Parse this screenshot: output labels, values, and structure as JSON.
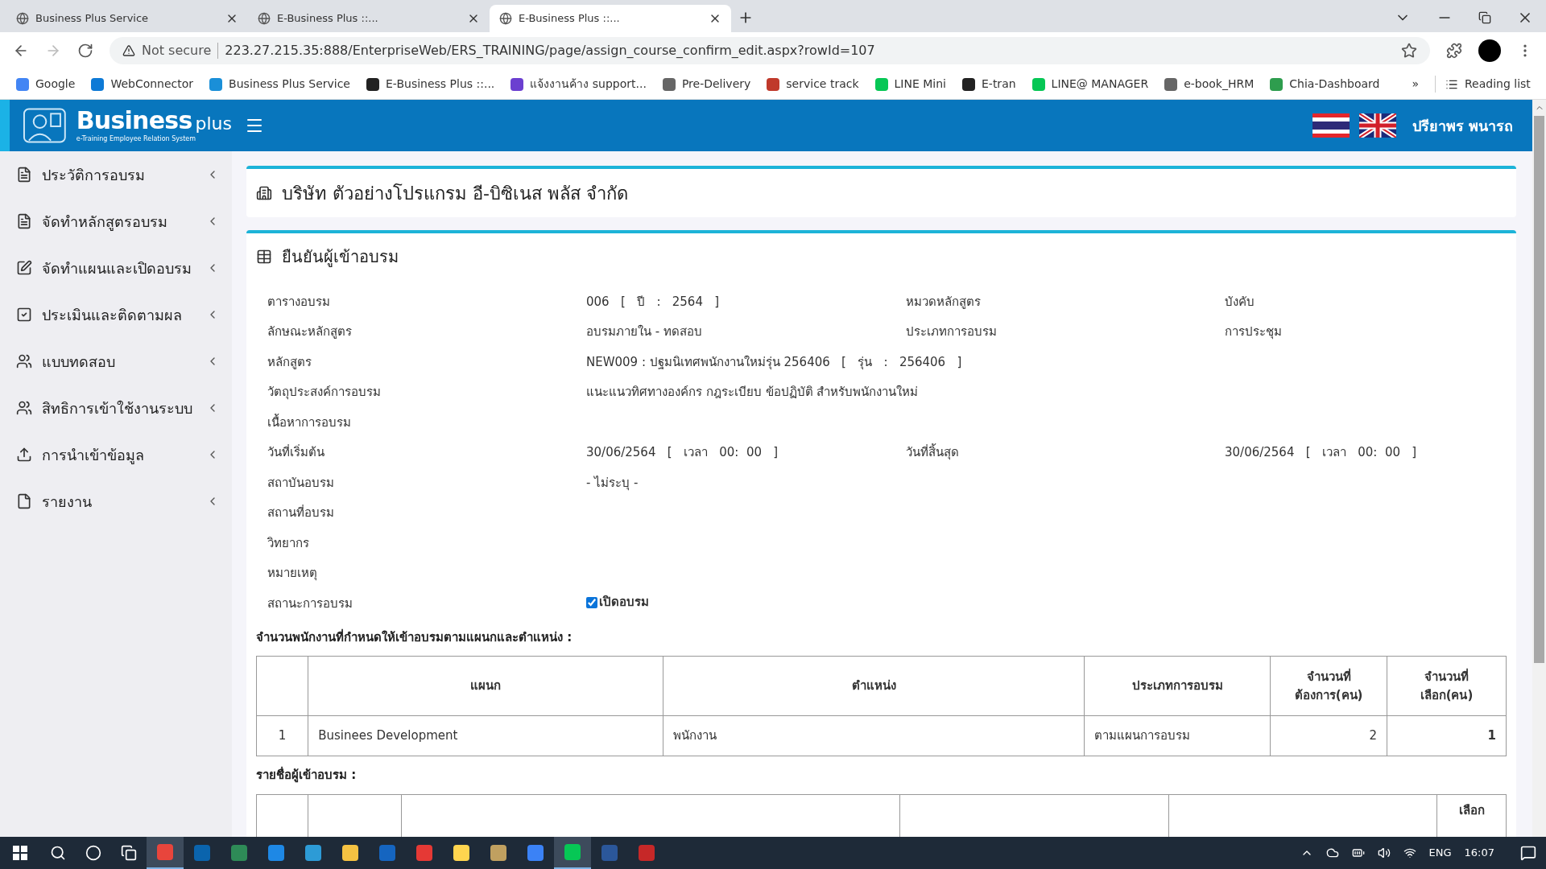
{
  "browser": {
    "tabs": [
      {
        "title": "Business Plus Service",
        "selected": false
      },
      {
        "title": "E-Business Plus ::...",
        "selected": false
      },
      {
        "title": "E-Business Plus ::...",
        "selected": true
      }
    ],
    "security": "Not secure",
    "url": "223.27.215.35:888/EnterpriseWeb/ERS_TRAINING/page/assign_course_confirm_edit.aspx?rowId=107",
    "bookmarks": [
      "Google",
      "WebConnector",
      "Business Plus Service",
      "E-Business Plus ::...",
      "แจ้งงานค้าง support...",
      "Pre-Delivery",
      "service track",
      "LINE Mini",
      "E-tran",
      "LINE@ MANAGER",
      "e-book_HRM",
      "Chia-Dashboard"
    ],
    "more": "»",
    "reading_list": "Reading list"
  },
  "header": {
    "brand": "Business",
    "brand_suffix": "plus",
    "tagline": "e-Training Employee Relation System",
    "user": "ปรียาพร พนารถ"
  },
  "sidebar": {
    "items": [
      {
        "label": "ประวัติการอบรม",
        "kind": "file"
      },
      {
        "label": "จัดทำหลักสูตรอบรม",
        "kind": "file"
      },
      {
        "label": "จัดทำแผนและเปิดอบรม",
        "kind": "edit"
      },
      {
        "label": "ประเมินและติดตามผล",
        "kind": "check"
      },
      {
        "label": "แบบทดสอบ",
        "kind": "users"
      },
      {
        "label": "สิทธิการเข้าใช้งานระบบ",
        "kind": "users"
      },
      {
        "label": "การนำเข้าข้อมูล",
        "kind": "upload"
      },
      {
        "label": "รายงาน",
        "kind": "pdf"
      }
    ]
  },
  "company": "บริษัท ตัวอย่างโปรแกรม อี-บิซิเนส พลัส จำกัด",
  "section_title": "ยืนยันผู้เข้าอบรม",
  "fields": [
    {
      "label": "ตารางอบรม",
      "value": "006   [   ปี   :   2564   ]",
      "label2": "หมวดหลักสูตร",
      "value2": "บังคับ"
    },
    {
      "label": "ลักษณะหลักสูตร",
      "value": "อบรมภายใน - ทดสอบ",
      "label2": "ประเภทการอบรม",
      "value2": "การประชุม"
    },
    {
      "label": "หลักสูตร",
      "value": "NEW009 : ปฐมนิเทศพนักงานใหม่รุ่น 256406   [   รุ่น   :   256406   ]"
    },
    {
      "label": "วัตถุประสงค์การอบรม",
      "value": "แนะแนวทิศทางองค์กร กฎระเบียบ ข้อปฏิบัติ สำหรับพนักงานใหม่"
    },
    {
      "label": "เนื้อหาการอบรม"
    },
    {
      "label": "วันที่เริ่มต้น",
      "value": "30/06/2564   [   เวลา   00:  00   ]",
      "label2": "วันที่สิ้นสุด",
      "value2": "30/06/2564   [   เวลา   00:  00   ]"
    },
    {
      "label": "สถาบันอบรม",
      "value": "- ไม่ระบุ -"
    },
    {
      "label": "สถานที่อบรม"
    },
    {
      "label": "วิทยากร"
    },
    {
      "label": "หมายเหตุ"
    },
    {
      "label": "สถานะการอบรม",
      "checkbox": {
        "label": "เปิดอบรม",
        "checked": true
      }
    }
  ],
  "quota": {
    "title": "จำนวนพนักงานที่กำหนดให้เข้าอบรมตามแผนกและตำแหน่ง :",
    "columns": [
      "",
      "แผนก",
      "ตำแหน่ง",
      "ประเภทการอบรม",
      "จำนวนที่ต้องการ(คน)",
      "จำนวนที่เลือก(คน)"
    ],
    "rows": [
      [
        "1",
        "Businees Development",
        "พนักงาน",
        "ตามแผนการอบรม",
        "2",
        "1"
      ]
    ]
  },
  "attendees": {
    "title": "รายชื่อผู้เข้าอบรม :",
    "columns": [
      "",
      "",
      "",
      "",
      "",
      "เลือก"
    ]
  },
  "taskbar": {
    "language": "ENG",
    "time": "16:07"
  }
}
